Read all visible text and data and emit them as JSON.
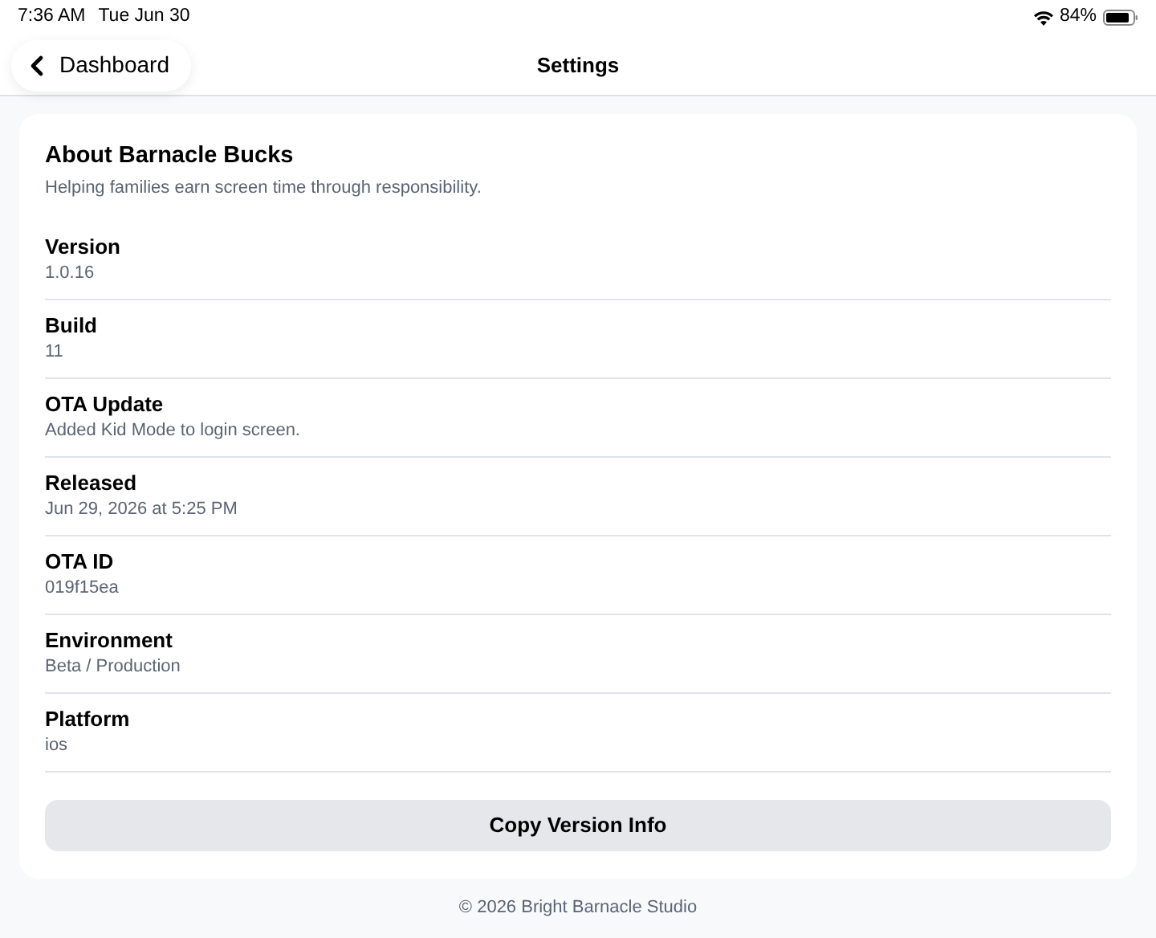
{
  "status_bar": {
    "time": "7:36 AM",
    "date": "Tue Jun 30",
    "battery": "84%"
  },
  "nav": {
    "back": "Dashboard",
    "title": "Settings"
  },
  "card": {
    "title": "About Barnacle Bucks",
    "subtitle": "Helping families earn screen time through responsibility.",
    "rows": [
      {
        "label": "Version",
        "value": "1.0.16"
      },
      {
        "label": "Build",
        "value": "11"
      },
      {
        "label": "OTA Update",
        "value": "Added Kid Mode to login screen."
      },
      {
        "label": "Released",
        "value": "Jun 29, 2026 at 5:25 PM"
      },
      {
        "label": "OTA ID",
        "value": "019f15ea"
      },
      {
        "label": "Environment",
        "value": "Beta / Production"
      },
      {
        "label": "Platform",
        "value": "ios"
      }
    ],
    "button": "Copy Version Info"
  },
  "footer": "© 2026 Bright Barnacle Studio"
}
